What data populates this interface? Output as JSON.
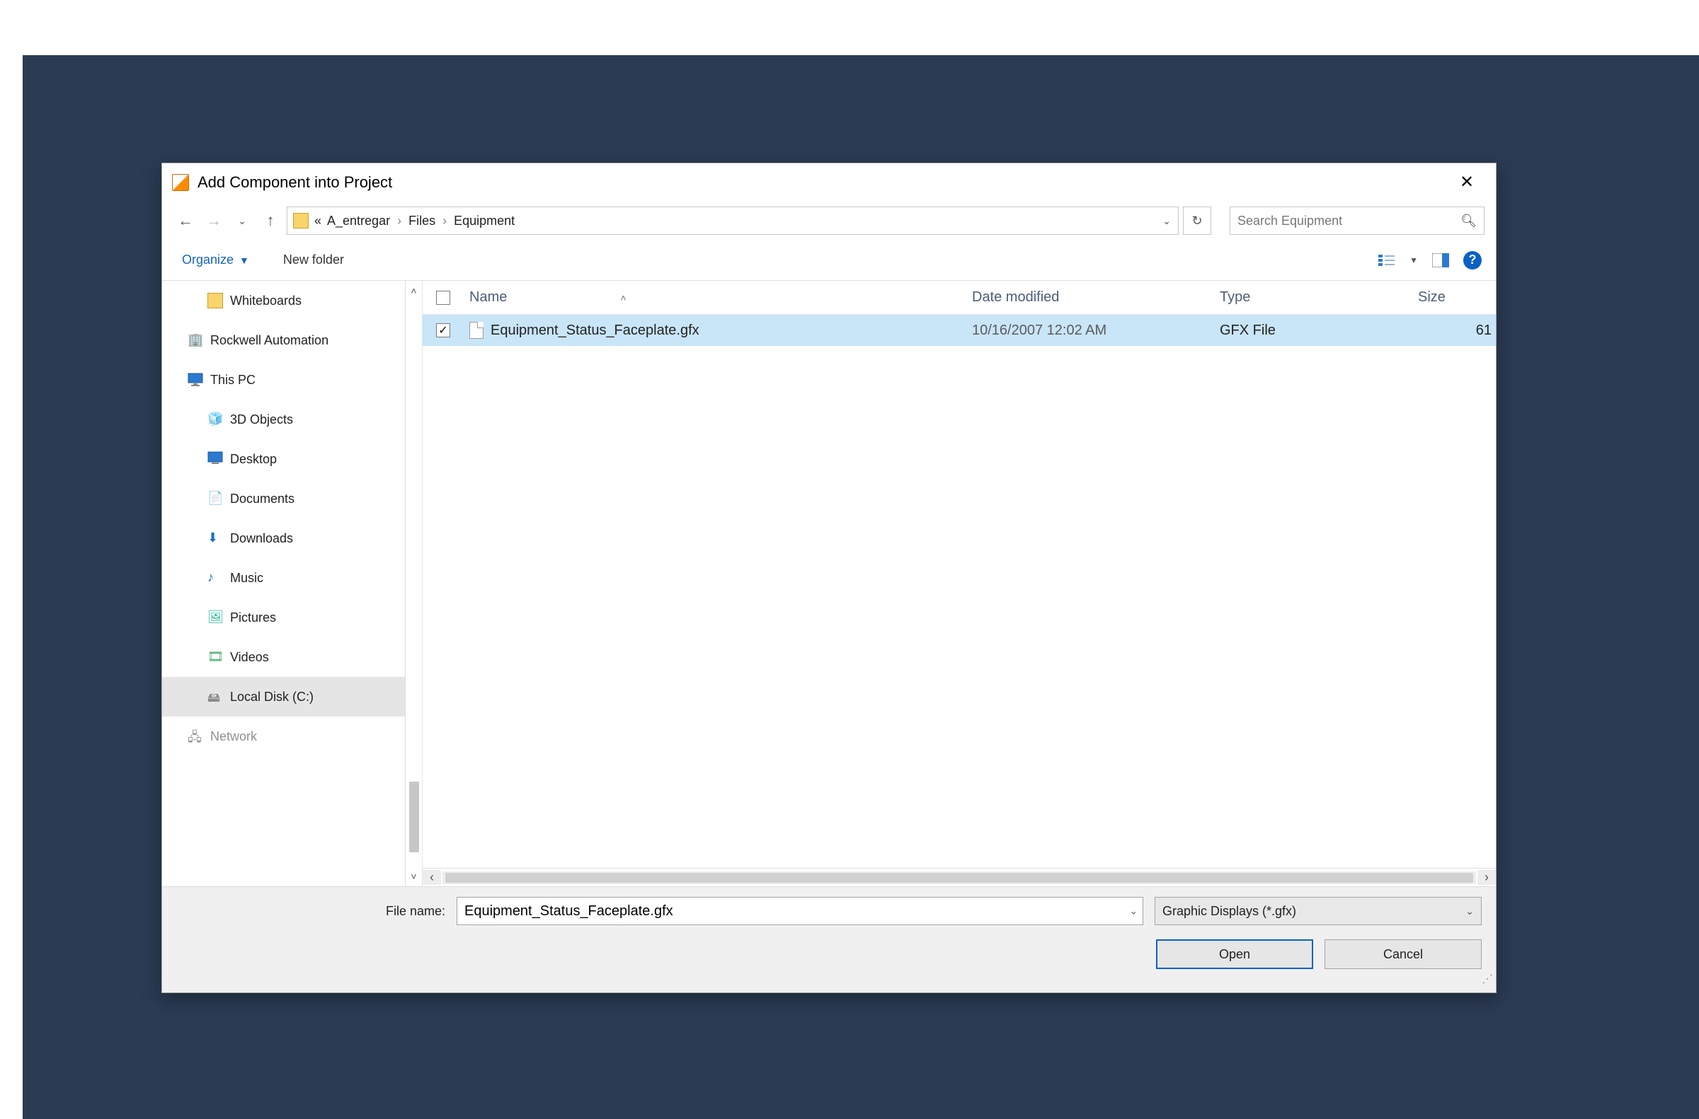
{
  "window": {
    "title": "Add Component into Project"
  },
  "nav": {
    "back_enabled": true,
    "forward_enabled": false
  },
  "breadcrumb": {
    "prefix": "«",
    "parts": [
      "A_entregar",
      "Files",
      "Equipment"
    ]
  },
  "search": {
    "placeholder": "Search Equipment"
  },
  "toolbar": {
    "organize": "Organize",
    "newfolder": "New folder"
  },
  "sidebar": {
    "items": [
      {
        "label": "Whiteboards",
        "icon": "folder",
        "indent": 1
      },
      {
        "label": "Rockwell Automation",
        "icon": "building",
        "indent": 0
      },
      {
        "label": "This PC",
        "icon": "pc",
        "indent": 0
      },
      {
        "label": "3D Objects",
        "icon": "3d",
        "indent": 1
      },
      {
        "label": "Desktop",
        "icon": "desktop",
        "indent": 1
      },
      {
        "label": "Documents",
        "icon": "docs",
        "indent": 1
      },
      {
        "label": "Downloads",
        "icon": "download",
        "indent": 1
      },
      {
        "label": "Music",
        "icon": "music",
        "indent": 1
      },
      {
        "label": "Pictures",
        "icon": "pic",
        "indent": 1
      },
      {
        "label": "Videos",
        "icon": "video",
        "indent": 1
      },
      {
        "label": "Local Disk (C:)",
        "icon": "drive",
        "indent": 1,
        "selected": true
      },
      {
        "label": "Network",
        "icon": "network",
        "indent": 0
      }
    ]
  },
  "columns": {
    "name": "Name",
    "date": "Date modified",
    "type": "Type",
    "size": "Size"
  },
  "files": [
    {
      "checked": true,
      "name": "Equipment_Status_Faceplate.gfx",
      "date": "10/16/2007 12:02 AM",
      "type": "GFX File",
      "size": "61",
      "selected": true
    }
  ],
  "footer": {
    "filename_label": "File name:",
    "filename_value": "Equipment_Status_Faceplate.gfx",
    "filter": "Graphic Displays (*.gfx)",
    "open": "Open",
    "cancel": "Cancel"
  }
}
